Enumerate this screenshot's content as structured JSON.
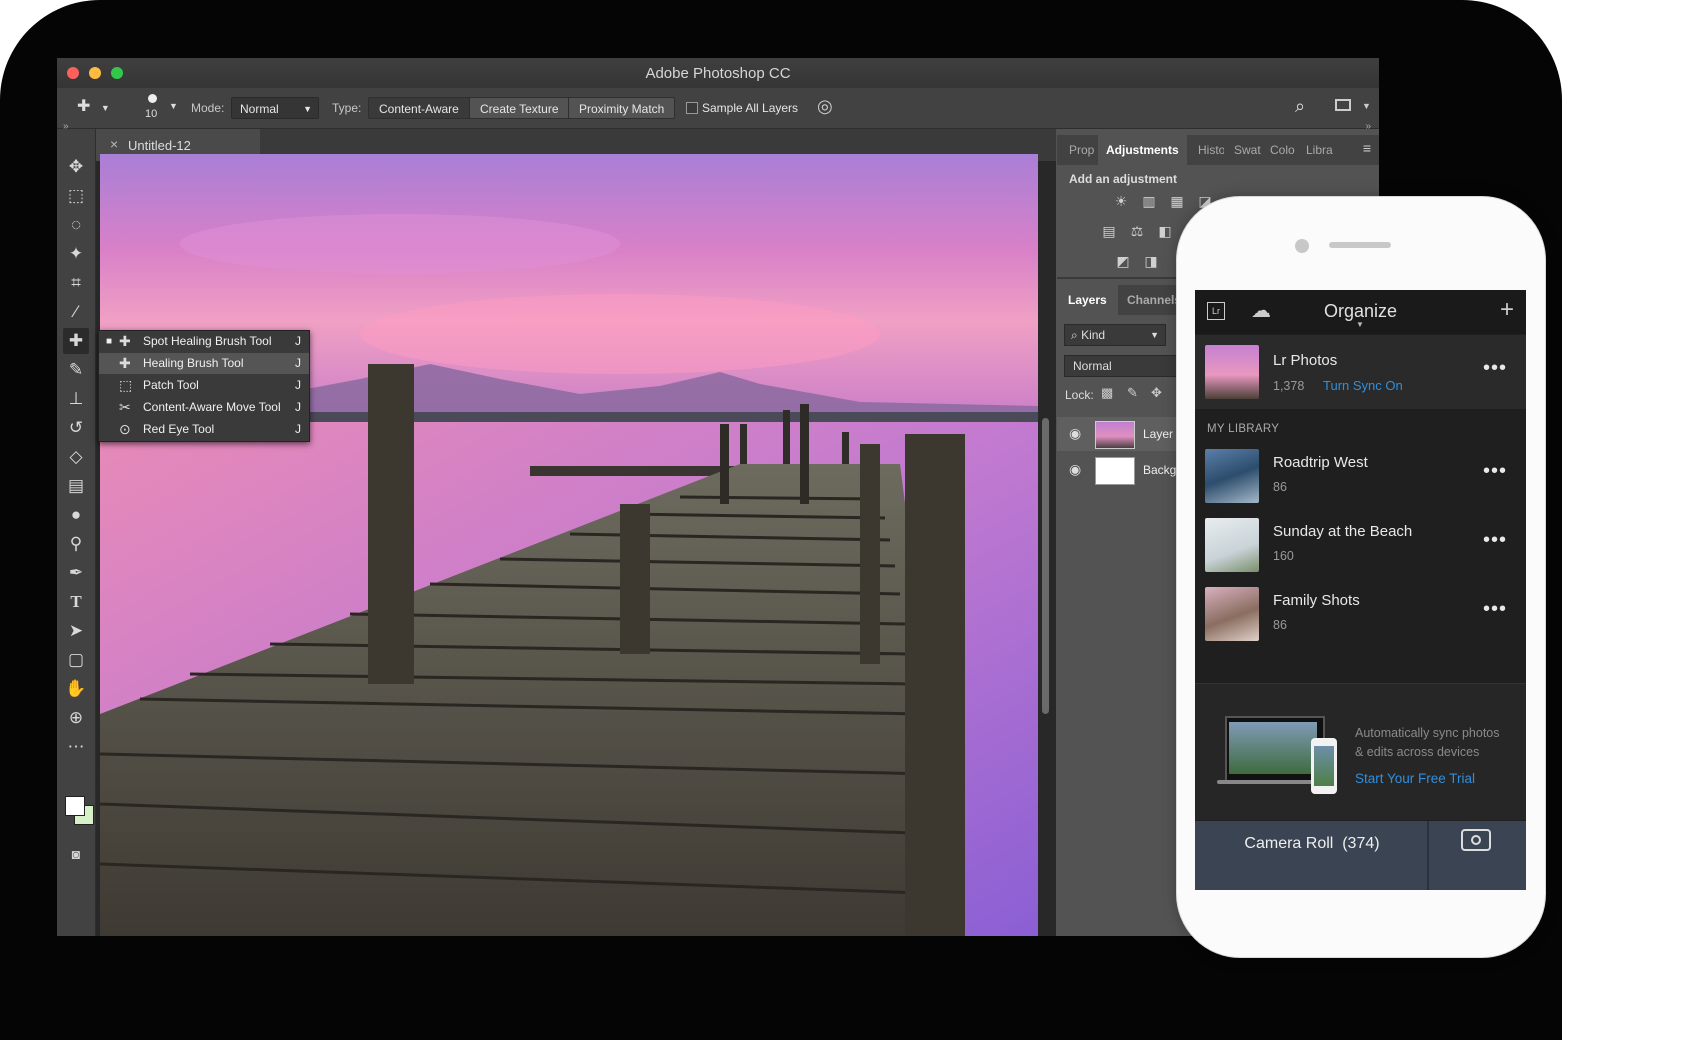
{
  "app_title": "Adobe Photoshop CC",
  "options_bar": {
    "brush_size": "10",
    "mode_label": "Mode:",
    "mode_value": "Normal",
    "type_label": "Type:",
    "type_options": [
      "Content-Aware",
      "Create Texture",
      "Proximity Match"
    ],
    "sample_all_layers": "Sample All Layers"
  },
  "document": {
    "tab_title": "Untitled-12",
    "close_glyph": "×"
  },
  "tool_flyout": [
    {
      "label": "Spot Healing Brush Tool",
      "shortcut": "J",
      "icon": "spot-healing-icon",
      "selected": true
    },
    {
      "label": "Healing Brush Tool",
      "shortcut": "J",
      "icon": "healing-brush-icon"
    },
    {
      "label": "Patch Tool",
      "shortcut": "J",
      "icon": "patch-icon"
    },
    {
      "label": "Content-Aware Move Tool",
      "shortcut": "J",
      "icon": "content-aware-move-icon"
    },
    {
      "label": "Red Eye Tool",
      "shortcut": "J",
      "icon": "red-eye-icon"
    }
  ],
  "panels": {
    "top_tabs": [
      "Prop",
      "Adjustments",
      "Histo",
      "Swat",
      "Colo",
      "Libra"
    ],
    "active_tab": "Adjustments",
    "add_adjustment": "Add an adjustment",
    "layer_tabs": [
      "Layers",
      "Channels"
    ],
    "kind_filter": "Kind",
    "blend_mode": "Normal",
    "lock_label": "Lock:",
    "layers": [
      {
        "name": "Layer",
        "visible": true
      },
      {
        "name": "Background",
        "visible": true
      }
    ]
  },
  "phone": {
    "header_title": "Organize",
    "lr_photos": {
      "title": "Lr Photos",
      "count": "1,378",
      "sync_link": "Turn Sync On"
    },
    "section_title": "MY LIBRARY",
    "albums": [
      {
        "title": "Roadtrip West",
        "count": "86"
      },
      {
        "title": "Sunday at the Beach",
        "count": "160"
      },
      {
        "title": "Family Shots",
        "count": "86"
      }
    ],
    "promo": {
      "text_line1": "Automatically sync photos",
      "text_line2": "& edits across devices",
      "link": "Start Your Free Trial"
    },
    "camera_roll": "Camera Roll  (374)",
    "more_glyph": "•••"
  },
  "colors": {
    "accent_blue": "#2f8fdf",
    "ps_panel": "#535353",
    "ps_bar": "#424242",
    "lr_bg": "#1f1f1f"
  }
}
